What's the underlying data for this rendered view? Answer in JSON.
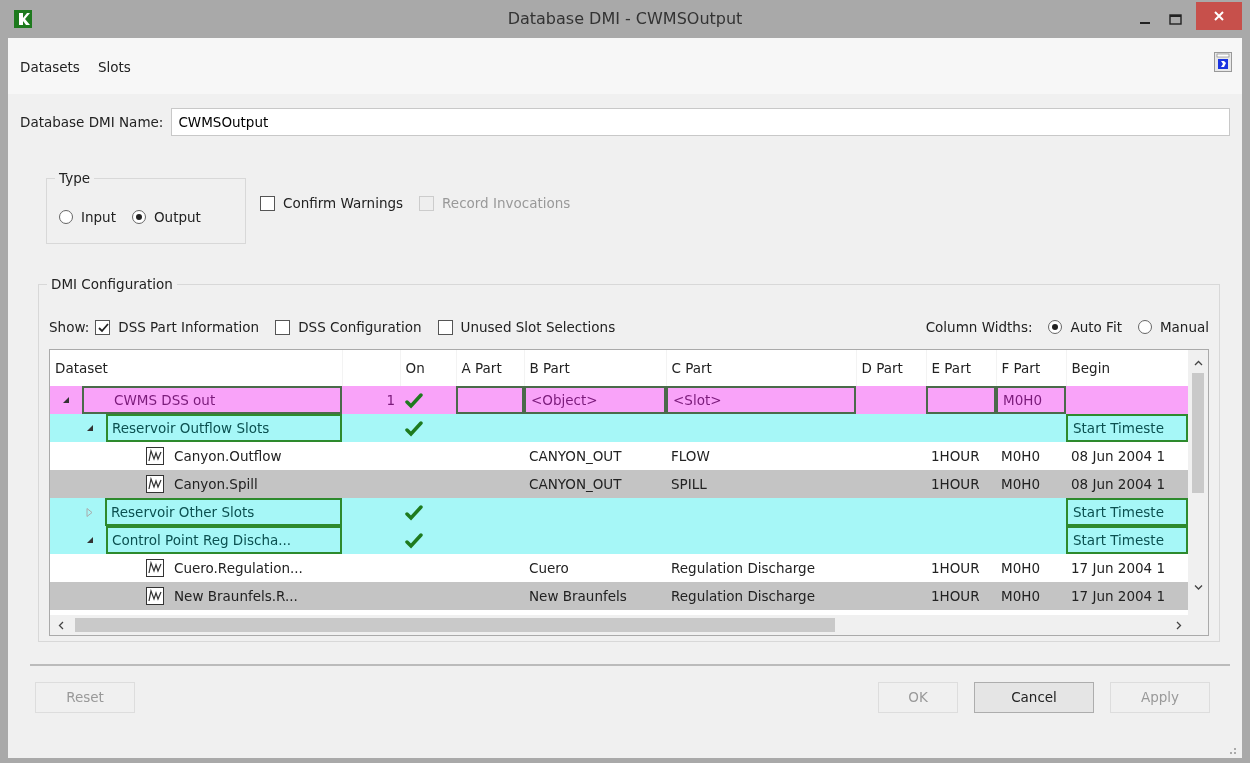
{
  "window": {
    "title": "Database DMI - CWMSOutput"
  },
  "menu": [
    "Datasets",
    "Slots"
  ],
  "name_field": {
    "label": "Database DMI Name:",
    "value": "CWMSOutput"
  },
  "type_group": {
    "title": "Type",
    "options": [
      {
        "label": "Input",
        "selected": false
      },
      {
        "label": "Output",
        "selected": true
      }
    ]
  },
  "options": [
    {
      "label": "Confirm Warnings",
      "checked": false,
      "disabled": false
    },
    {
      "label": "Record Invocations",
      "checked": false,
      "disabled": true
    }
  ],
  "dmi_configuration": {
    "title": "DMI Configuration",
    "show_label": "Show:",
    "show_options": [
      {
        "label": "DSS Part Information",
        "checked": true
      },
      {
        "label": "DSS Configuration",
        "checked": false
      },
      {
        "label": "Unused Slot Selections",
        "checked": false
      }
    ],
    "column_widths_label": "Column Widths:",
    "column_widths_options": [
      {
        "label": "Auto Fit",
        "selected": true
      },
      {
        "label": "Manual",
        "selected": false
      }
    ],
    "table": {
      "columns": [
        "Dataset",
        "On",
        "A Part",
        "B Part",
        "C Part",
        "D Part",
        "E Part",
        "F Part",
        "Begin"
      ],
      "rows": [
        {
          "kind": "dataset",
          "name": "CWMS DSS out",
          "count": "1",
          "on": true,
          "expanded": true,
          "b_part": "<Object>",
          "c_part": "<Slot>",
          "f_part": "M0H0",
          "children": [
            {
              "kind": "group",
              "name": "Reservoir Outflow Slots",
              "on": true,
              "expanded": true,
              "begin": "Start Timeste",
              "children": [
                {
                  "kind": "slot",
                  "name": "Canyon.Outflow",
                  "b_part": "CANYON_OUT",
                  "c_part": "FLOW",
                  "e_part": "1HOUR",
                  "f_part": "M0H0",
                  "begin": "08 Jun 2004 1"
                },
                {
                  "kind": "slot",
                  "name": "Canyon.Spill",
                  "b_part": "CANYON_OUT",
                  "c_part": "SPILL",
                  "e_part": "1HOUR",
                  "f_part": "M0H0",
                  "begin": "08 Jun 2004 1"
                }
              ]
            },
            {
              "kind": "group",
              "name": "Reservoir Other Slots",
              "on": true,
              "expanded": false,
              "begin": "Start Timeste"
            },
            {
              "kind": "group",
              "name": "Control Point Reg Discha...",
              "on": true,
              "expanded": true,
              "begin": "Start Timeste",
              "children": [
                {
                  "kind": "slot",
                  "name": "Cuero.Regulation...",
                  "b_part": "Cuero",
                  "c_part": "Regulation Discharge",
                  "e_part": "1HOUR",
                  "f_part": "M0H0",
                  "begin": "17 Jun 2004 1"
                },
                {
                  "kind": "slot",
                  "name": "New Braunfels.R...",
                  "b_part": "New Braunfels",
                  "c_part": "Regulation Discharge",
                  "e_part": "1HOUR",
                  "f_part": "M0H0",
                  "begin": "17 Jun 2004 1"
                }
              ]
            }
          ]
        }
      ]
    }
  },
  "buttons": [
    {
      "label": "Reset",
      "disabled": true
    },
    {
      "label": "OK",
      "disabled": true
    },
    {
      "label": "Cancel",
      "disabled": false
    },
    {
      "label": "Apply",
      "disabled": true
    }
  ]
}
